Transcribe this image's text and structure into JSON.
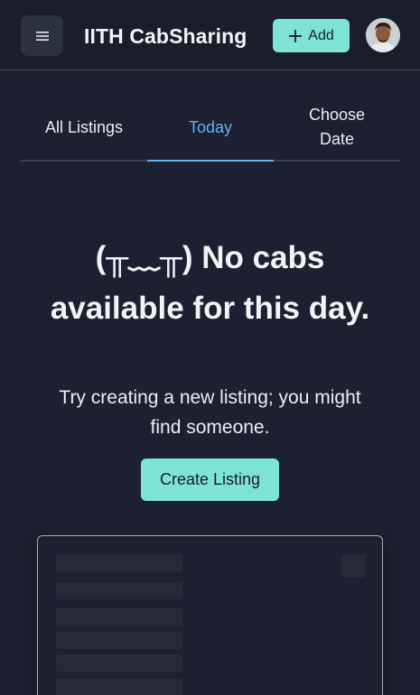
{
  "header": {
    "title": "IITH CabSharing",
    "add_label": "Add",
    "icons": {
      "menu": "hamburger-menu-icon",
      "add": "plus-icon"
    }
  },
  "tabs": [
    {
      "label": "All Listings",
      "active": false
    },
    {
      "label": "Today",
      "active": true
    },
    {
      "label": "Choose Date",
      "active": false
    }
  ],
  "empty_state": {
    "title": "(╥﹏╥) No cabs available for this day.",
    "subtitle": "Try creating a new listing; you might find someone.",
    "button_label": "Create Listing"
  },
  "colors": {
    "background": "#1c2030",
    "header": "#1a1d2a",
    "accent_button": "#7de3d4",
    "active_tab": "#63b3ed",
    "skeleton": "#262a38"
  }
}
